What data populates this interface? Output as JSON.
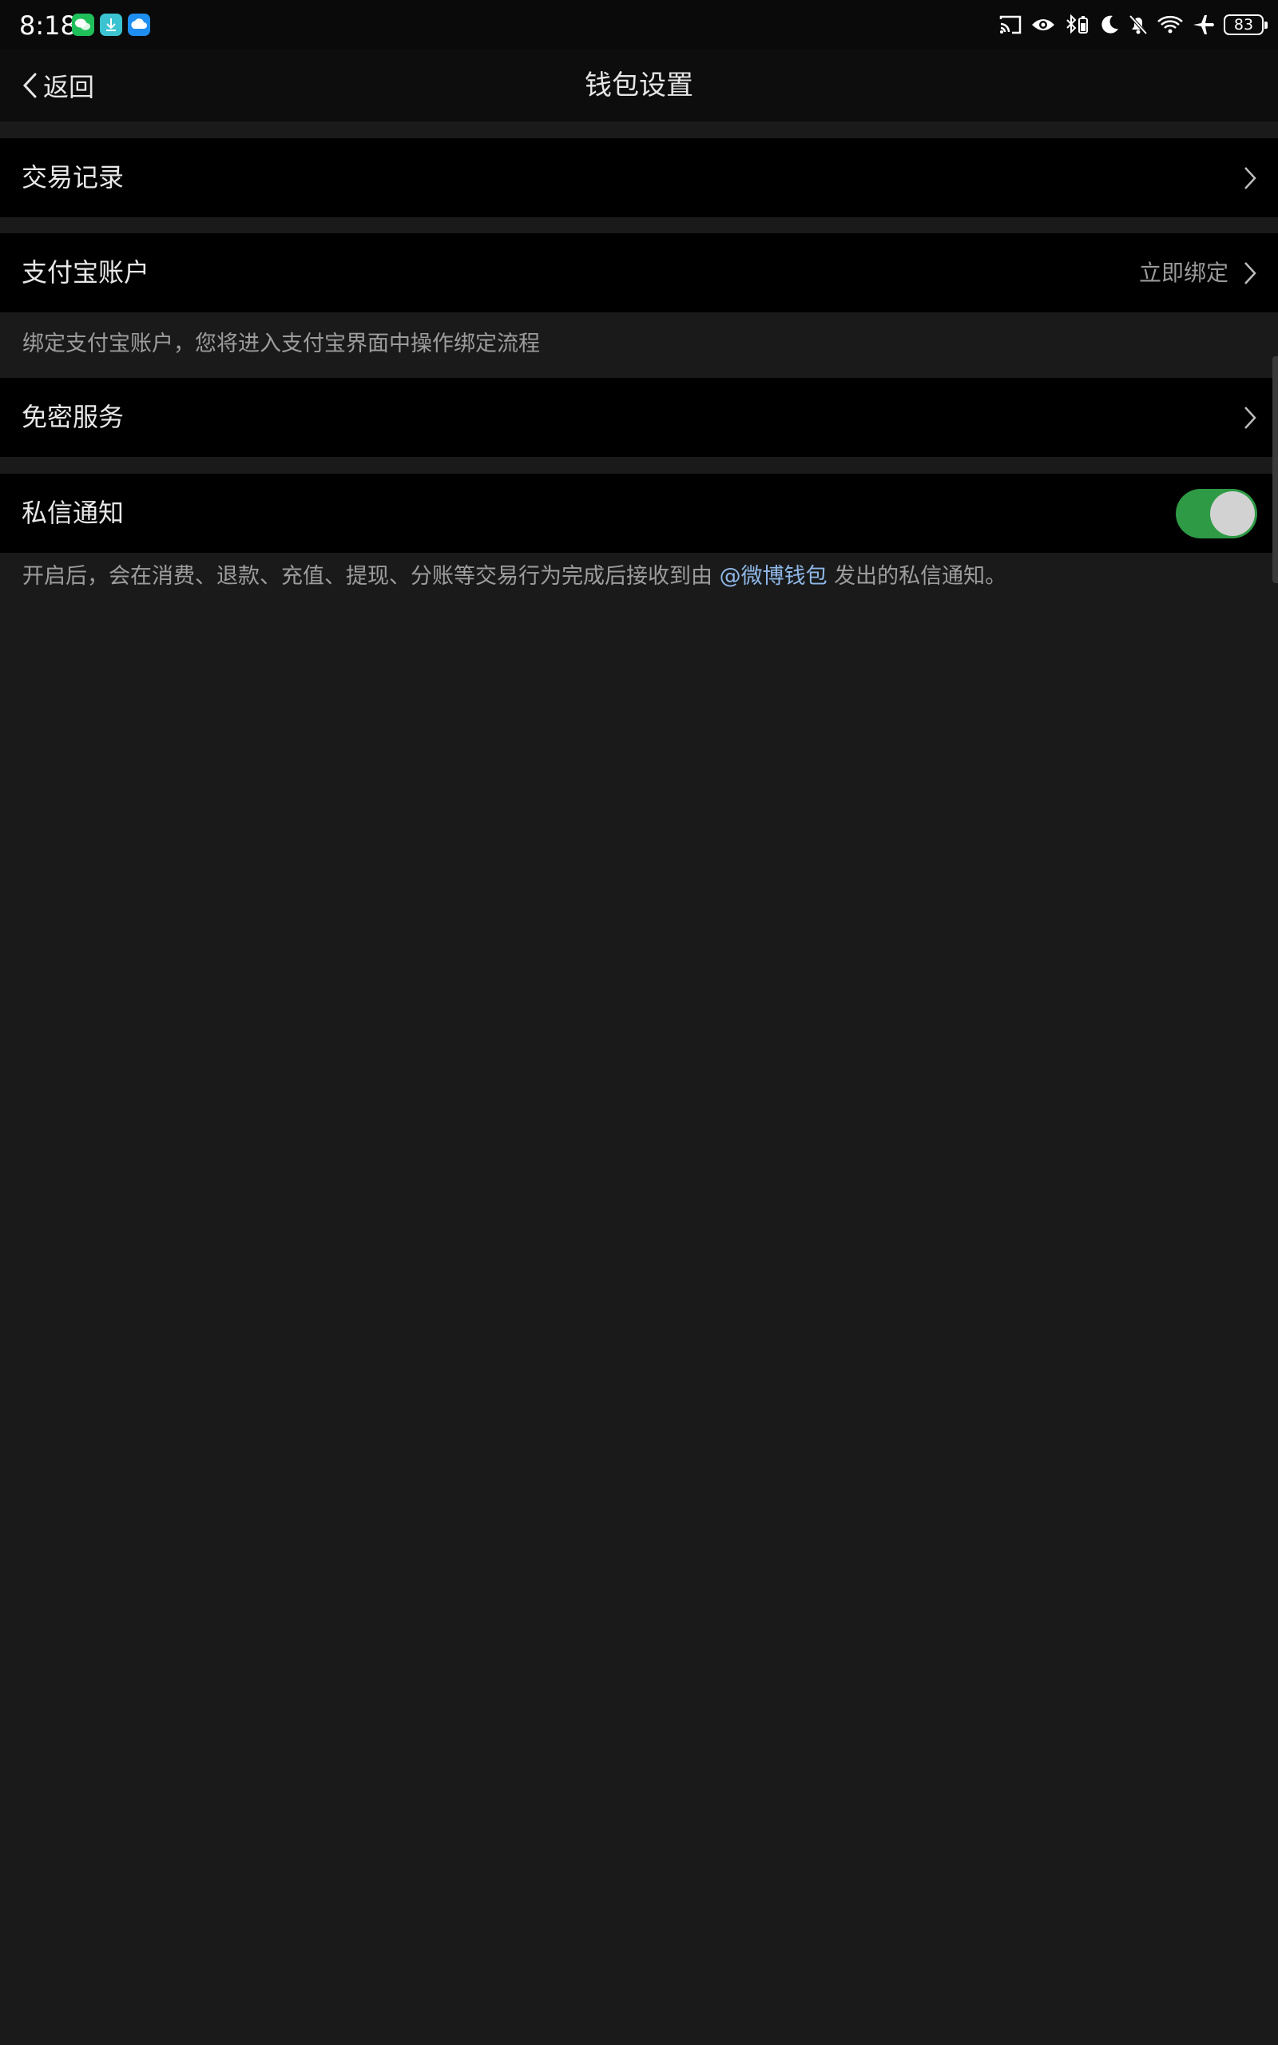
{
  "status_bar": {
    "time": "8:18",
    "apps": [
      {
        "name": "wechat-icon",
        "color": "#1fbf5a"
      },
      {
        "name": "download-icon",
        "color": "#3bc3d1"
      },
      {
        "name": "cloud-icon",
        "color": "#1f8ef1"
      }
    ],
    "battery": "83"
  },
  "nav": {
    "back_label": "返回",
    "title": "钱包设置"
  },
  "rows": {
    "transactions": {
      "label": "交易记录"
    },
    "alipay": {
      "label": "支付宝账户",
      "value": "立即绑定"
    },
    "alipay_hint": "绑定支付宝账户，您将进入支付宝界面中操作绑定流程",
    "password_free": {
      "label": "免密服务"
    },
    "dm_notify": {
      "label": "私信通知",
      "enabled": true
    }
  },
  "notify_hint": {
    "before": "开启后，会在消费、退款、充值、提现、分账等交易行为完成后接收到由 ",
    "link": "@微博钱包",
    "after": " 发出的私信通知。"
  },
  "colors": {
    "toggle_on": "#2e9a45",
    "link": "#8fb8e8",
    "background": "#1a1a1a",
    "row_background": "#000000"
  }
}
